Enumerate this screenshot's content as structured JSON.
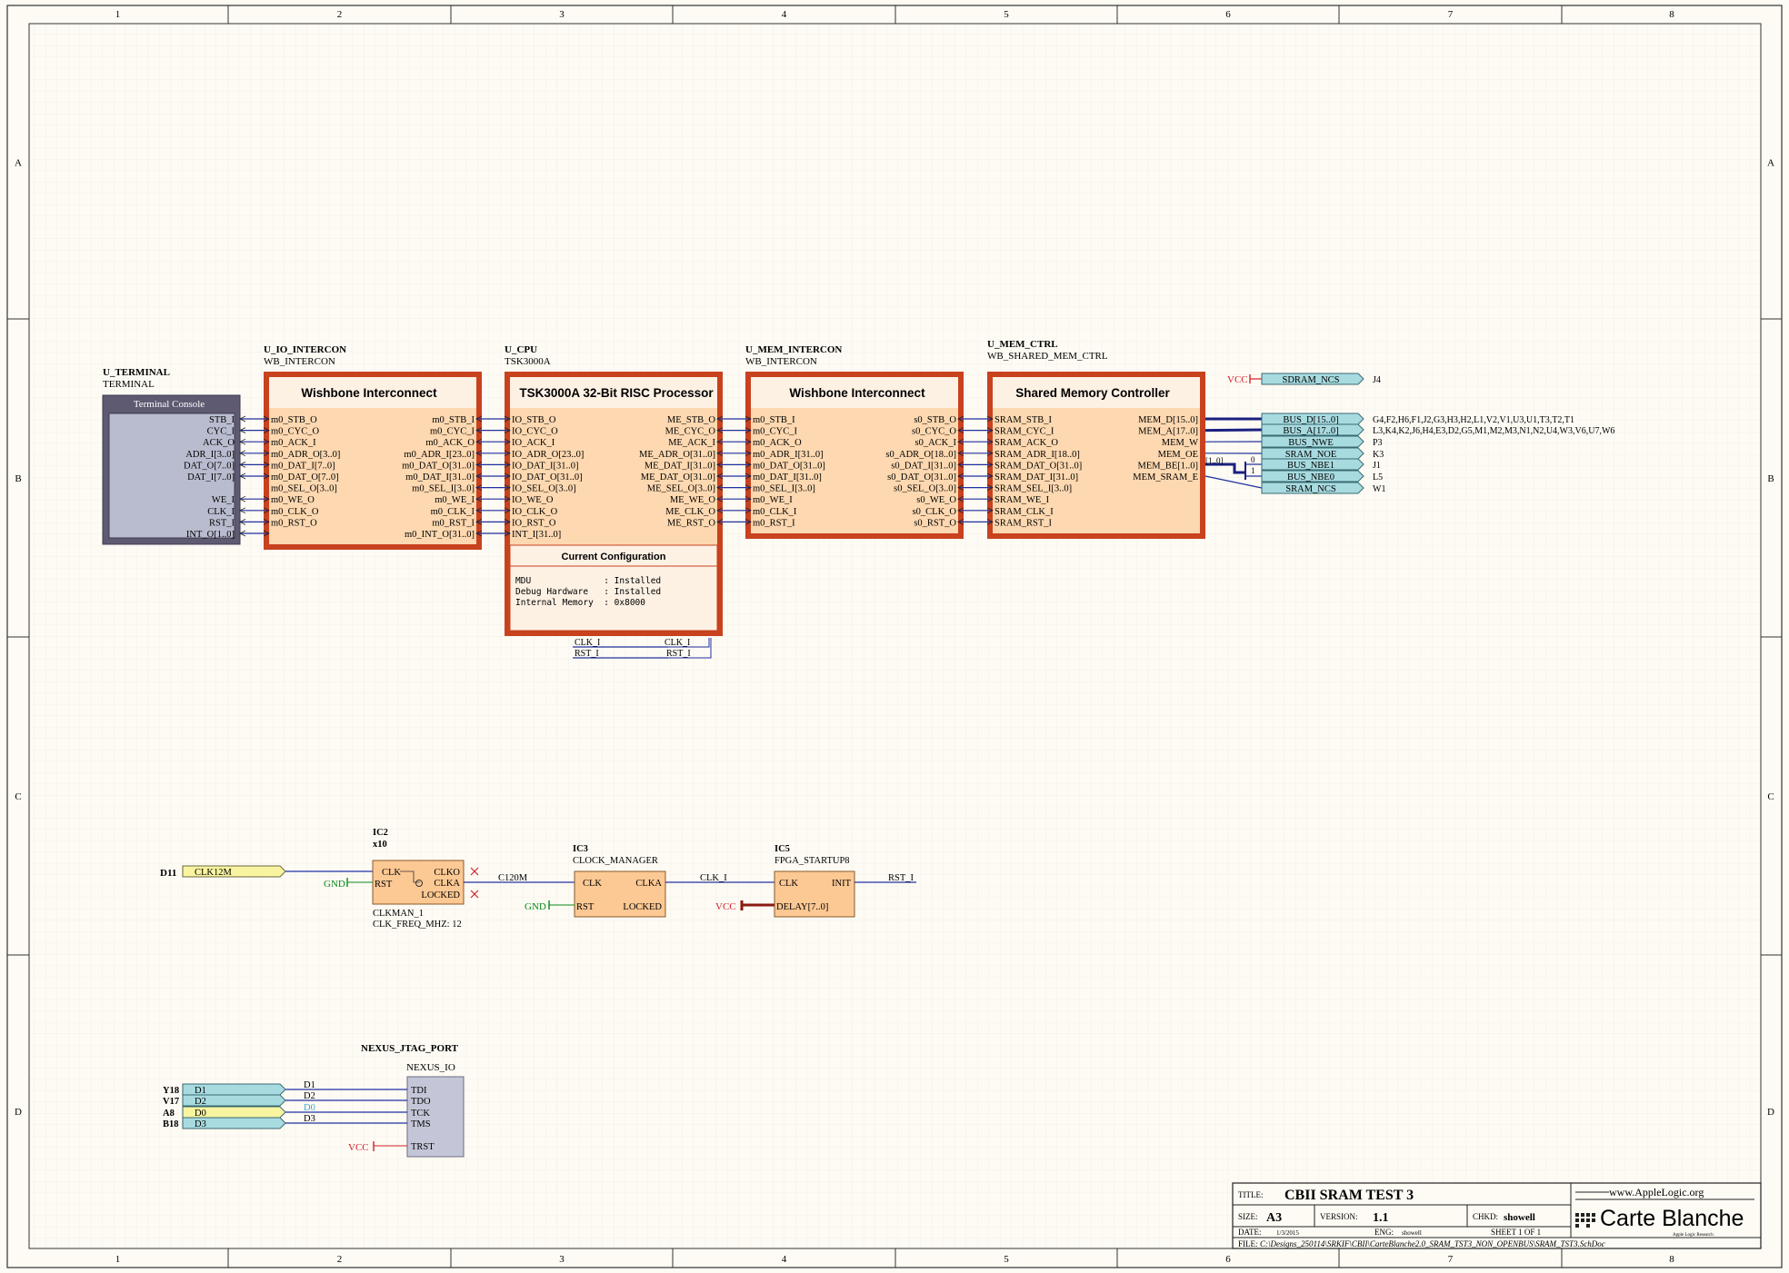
{
  "sheet": {
    "col_labels": [
      "1",
      "2",
      "3",
      "4",
      "5",
      "6",
      "7",
      "8"
    ],
    "row_labels": [
      "A",
      "B",
      "C",
      "D"
    ]
  },
  "components": {
    "terminal": {
      "designator": "U_TERMINAL",
      "type": "TERMINAL",
      "title": "Terminal Console",
      "pins": [
        "STB_I",
        "CYC_I",
        "ACK_O",
        "ADR_I[3..0]",
        "DAT_O[7..0]",
        "DAT_I[7..0]",
        "",
        "WE_I",
        "CLK_I",
        "RST_I",
        "INT_O[1..0]"
      ]
    },
    "io_intercon": {
      "designator": "U_IO_INTERCON",
      "type": "WB_INTERCON",
      "title": "Wishbone Interconnect",
      "left_pins": [
        "m0_STB_O",
        "m0_CYC_O",
        "m0_ACK_I",
        "m0_ADR_O[3..0]",
        "m0_DAT_I[7..0]",
        "m0_DAT_O[7..0]",
        "m0_SEL_O[3..0]",
        "m0_WE_O",
        "m0_CLK_O",
        "m0_RST_O"
      ],
      "right_pins": [
        "m0_STB_I",
        "m0_CYC_I",
        "m0_ACK_O",
        "m0_ADR_I[23..0]",
        "m0_DAT_O[31..0]",
        "m0_DAT_I[31..0]",
        "m0_SEL_I[3..0]",
        "m0_WE_I",
        "m0_CLK_I",
        "m0_RST_I",
        "m0_INT_O[31..0]"
      ]
    },
    "cpu": {
      "designator": "U_CPU",
      "type": "TSK3000A",
      "title": "TSK3000A 32-Bit RISC Processor",
      "left_pins": [
        "IO_STB_O",
        "IO_CYC_O",
        "IO_ACK_I",
        "IO_ADR_O[23..0]",
        "IO_DAT_I[31..0]",
        "IO_DAT_O[31..0]",
        "IO_SEL_O[3..0]",
        "IO_WE_O",
        "IO_CLK_O",
        "IO_RST_O",
        "INT_I[31..0]"
      ],
      "right_pins": [
        "ME_STB_O",
        "ME_CYC_O",
        "ME_ACK_I",
        "ME_ADR_O[31..0]",
        "ME_DAT_I[31..0]",
        "ME_DAT_O[31..0]",
        "ME_SEL_O[3..0]",
        "ME_WE_O",
        "ME_CLK_O",
        "ME_RST_O"
      ],
      "config_title": "Current Configuration",
      "config_lines": [
        "MDU              : Installed",
        "Debug Hardware   : Installed",
        "Internal Memory  : 0x8000"
      ],
      "clk_nets": [
        "CLK_I",
        "RST_I"
      ]
    },
    "mem_intercon": {
      "designator": "U_MEM_INTERCON",
      "type": "WB_INTERCON",
      "title": "Wishbone Interconnect",
      "left_pins": [
        "m0_STB_I",
        "m0_CYC_I",
        "m0_ACK_O",
        "m0_ADR_I[31..0]",
        "m0_DAT_O[31..0]",
        "m0_DAT_I[31..0]",
        "m0_SEL_I[3..0]",
        "m0_WE_I",
        "m0_CLK_I",
        "m0_RST_I"
      ],
      "right_pins": [
        "s0_STB_O",
        "s0_CYC_O",
        "s0_ACK_I",
        "s0_ADR_O[18..0]",
        "s0_DAT_I[31..0]",
        "s0_DAT_O[31..0]",
        "s0_SEL_O[3..0]",
        "s0_WE_O",
        "s0_CLK_O",
        "s0_RST_O"
      ]
    },
    "mem_ctrl": {
      "designator": "U_MEM_CTRL",
      "type": "WB_SHARED_MEM_CTRL",
      "title": "Shared Memory Controller",
      "left_pins": [
        "SRAM_STB_I",
        "SRAM_CYC_I",
        "SRAM_ACK_O",
        "SRAM_ADR_I[18..0]",
        "SRAM_DAT_O[31..0]",
        "SRAM_DAT_I[31..0]",
        "SRAM_SEL_I[3..0]",
        "SRAM_WE_I",
        "SRAM_CLK_I",
        "SRAM_RST_I"
      ],
      "right_pins": [
        "MEM_D[15..0]",
        "MEM_A[17..0]",
        "MEM_W",
        "MEM_OE",
        "MEM_BE[1..0]",
        "MEM_SRAM_E"
      ]
    },
    "ports": [
      {
        "name": "SDRAM_NCS",
        "pins": "J4"
      },
      {
        "name": "BUS_D[15..0]",
        "pins": "G4,F2,H6,F1,J2,G3,H3,H2,L1,V2,V1,U3,U1,T3,T2,T1"
      },
      {
        "name": "BUS_A[17..0]",
        "pins": "L3,K4,K2,J6,H4,E3,D2,G5,M1,M2,M3,N1,N2,U4,W3,V6,U7,W6"
      },
      {
        "name": "BUS_NWE",
        "pins": "P3"
      },
      {
        "name": "SRAM_NOE",
        "pins": "K3"
      },
      {
        "name": "BUS_NBE1",
        "pins": "J1"
      },
      {
        "name": "BUS_NBE0",
        "pins": "L5"
      },
      {
        "name": "SRAM_NCS",
        "pins": "W1"
      }
    ],
    "vcc": "VCC",
    "gnd": "GND",
    "be_bits": [
      "[1..0]",
      "0",
      "1"
    ],
    "ic2": {
      "designator": "IC2",
      "type": "x10",
      "pins_left": [
        "CLK",
        "RST"
      ],
      "pins_right": [
        "CLKO",
        "CLKA",
        "LOCKED"
      ],
      "sub1": "CLKMAN_1",
      "sub2": "CLK_FREQ_MHZ: 12"
    },
    "ic3": {
      "designator": "IC3",
      "type": "CLOCK_MANAGER",
      "pins_left": [
        "CLK",
        "RST"
      ],
      "pins_right": [
        "CLKA",
        "LOCKED"
      ]
    },
    "ic5": {
      "designator": "IC5",
      "type": "FPGA_STARTUP8",
      "pins_left": [
        "CLK",
        "DELAY[7..0]"
      ],
      "pins_right": [
        "INIT"
      ]
    },
    "clk_port": {
      "pin": "D11",
      "name": "CLK12M"
    },
    "nets": {
      "c120m": "C120M",
      "clk_i": "CLK_I",
      "rst_i": "RST_I"
    },
    "jtag": {
      "designator": "NEXUS_JTAG_PORT",
      "type": "NEXUS_IO",
      "ports": [
        {
          "pin": "Y18",
          "name": "D1"
        },
        {
          "pin": "V17",
          "name": "D2"
        },
        {
          "pin": "A8",
          "name": "D0"
        },
        {
          "pin": "B18",
          "name": "D3"
        }
      ],
      "nets": [
        "D1",
        "D2",
        "D0",
        "D3"
      ],
      "pins": [
        "TDI",
        "TDO",
        "TCK",
        "TMS",
        "TRST"
      ]
    }
  },
  "title_block": {
    "title_label": "TITLE:",
    "title": "CBII SRAM TEST 3",
    "size_label": "SIZE:",
    "size": "A3",
    "version_label": "VERSION:",
    "version": "1.1",
    "chkd_label": "CHKD:",
    "chkd": "showell",
    "date_label": "DATE:",
    "date": "1/3/2015",
    "eng_label": "ENG:",
    "eng": "showell",
    "sheet_text": "SHEET  1   OF   1",
    "file_label": "FILE:",
    "file": "C:\\Designs_250114\\SRKIF\\CBII\\CarteBlanche2.0_SRAM_TST3_NON_OPENBUS\\SRAM_TST3.SchDoc",
    "logo_top": "www.AppleLogic.org",
    "logo_main": "Carte Blanche",
    "logo_sub": "Apple Logic Research"
  }
}
